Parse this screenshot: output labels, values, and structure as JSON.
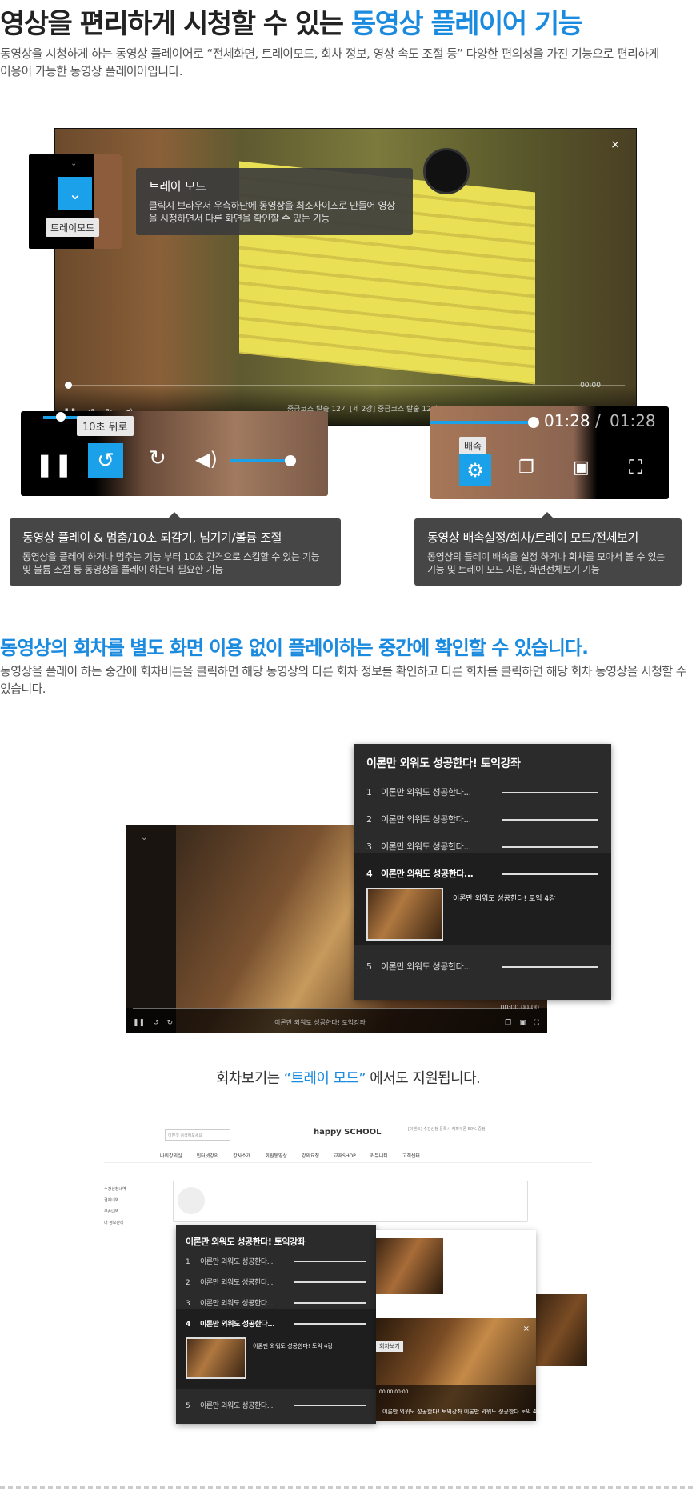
{
  "section1": {
    "title_prefix": "영상을 편리하게 시청할 수 있는 ",
    "title_highlight": "동영상 플레이어 기능",
    "description": "동영상을 시청하게 하는 동영상 플레이어로 “전체화면, 트레이모드, 회차 정보, 영상 속도 조절 등” 다양한 편의성을 가진 기능으로 편리하게 이용이 가능한 동영상 플레이어입니다.",
    "colors": {
      "accent": "#1b8be0",
      "button_blue": "#1aa1ea",
      "tip_bg": "#3c3c3c"
    }
  },
  "video1": {
    "close_icon": "×",
    "time": "00:00",
    "title": "중급코스 탈출 12기    [제 2강] 중급코스 탈출 12기"
  },
  "tray_popup": {
    "label": "트레이모드",
    "icon": "chevron-down-icon"
  },
  "tray_tip": {
    "title": "트레이 모드",
    "desc": "클릭시 브라우저 우측하단에 동영상을 최소사이즈로 만들어 영상을 시청하면서 다른 화면을 확인할 수 있는 기능"
  },
  "control_left": {
    "tooltip": "10초 뒤로",
    "pause_icon": "❚❚",
    "back_icon": "↺",
    "forward_icon": "↻",
    "volume_icon": "🔊",
    "volume_level": 0.9
  },
  "control_right": {
    "time_current": "01:28",
    "time_separator": "/",
    "time_total": "01:28",
    "tooltip": "배속",
    "gear_icon": "⚙",
    "episode_icon": "❐",
    "tray_icon": "▣",
    "fullscreen_icon": "⛶"
  },
  "tip_left": {
    "title": "동영상 플레이 & 멈춤/10초 되감기, 넘기기/볼륨 조절",
    "desc": "동영상을 플레이 하거나 멈추는 기능 부터 10초 간격으로 스킵할 수 있는 기능 및 볼륨 조절 등 동영상을 플레이 하는데 필요한 기능"
  },
  "tip_right": {
    "title": "동영상 배속설정/회차/트레이 모드/전체보기",
    "desc": "동영상의 플레이 배속을 설정 하거나 회차를 모아서 볼 수 있는 기능 및 트레이 모드 지원, 화면전체보기 기능"
  },
  "section2": {
    "title": "동영상의 회차를 별도 화면 이용 없이 플레이하는 중간에 확인할 수 있습니다.",
    "description": "동영상을 플레이 하는 중간에 회차버튼을 클릭하면 해당 동영상의 다른 회차 정보를 확인하고 다른 회차를 클릭하면 해당 회차 동영상을 시청할 수 있습니다."
  },
  "video2": {
    "time": "00:00    00:00",
    "title": "이론만 외워도 성공한다! 토익강좌"
  },
  "episode_panel": {
    "title": "이론만 외워도 성공한다! 토익강좌",
    "items": [
      {
        "num": "1",
        "label": "이론만 외워도 성공한다..."
      },
      {
        "num": "2",
        "label": "이론만 외워도 성공한다..."
      },
      {
        "num": "3",
        "label": "이론만 외워도 성공한다..."
      },
      {
        "num": "4",
        "label": "이론만 외워도 성공한다..."
      },
      {
        "num": "5",
        "label": "이론만 외워도 성공한다..."
      }
    ],
    "active_index": 3,
    "active_thumb_title": "이론만 외워도 성공한다! 토익 4강"
  },
  "section3": {
    "prefix": "회차보기는 ",
    "highlight": "“트레이 모드”",
    "suffix": " 에서도 지원됩니다."
  },
  "site": {
    "search_placeholder": "어떤것 검색해보세요",
    "logo": "happy SCHOOL",
    "nav": [
      "나의강의실",
      "인터넷강의",
      "강사소개",
      "회원동영상",
      "강의요청",
      "교재SHOP",
      "커뮤니티",
      "고객센터"
    ],
    "side": [
      "수강신청내역",
      "결제내역",
      "쿠폰내역",
      "내 정보관리"
    ],
    "right_text": "[이벤트] 수강신청 등록시 커피쿠폰 50% 증정"
  },
  "mini_video": {
    "tooltip": "회차보기",
    "title": "이론만 외워도 성공한다! 토익강좌 이론만 외워도 성공한다 토익 4강",
    "time": "00:00    00:00",
    "close_icon": "×"
  }
}
